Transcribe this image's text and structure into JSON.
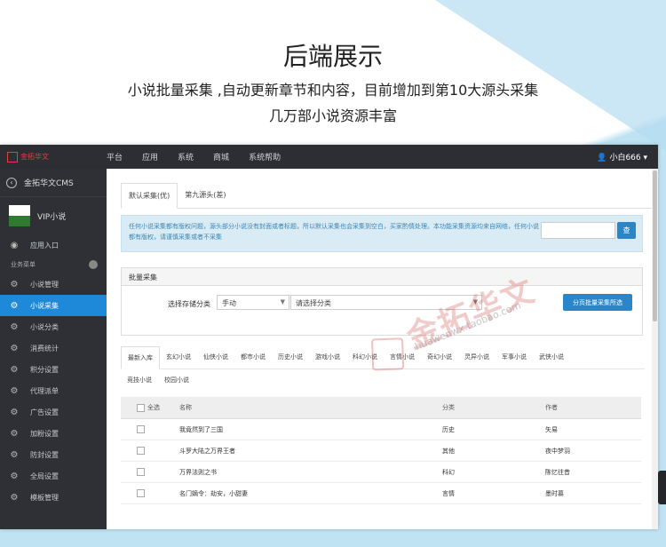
{
  "hero": {
    "title": "后端展示",
    "line1": "小说批量采集 ,自动更新章节和内容，目前增加到第10大源头采集",
    "line2": "几万部小说资源丰富"
  },
  "topbar": {
    "logo": "金拓华文",
    "nav": [
      "平台",
      "应用",
      "系统",
      "商城",
      "系统帮助"
    ],
    "user": "小白666 ▾"
  },
  "sidebar": {
    "brand": "金拓华文CMS",
    "vip": "VIP小说",
    "vip_img": "小说",
    "app_entry": "应用入口",
    "section": "业务菜单",
    "items": [
      "小说管理",
      "小说采集",
      "小说分类",
      "消费统计",
      "积分设置",
      "代理派单",
      "广告设置",
      "加粉设置",
      "防封设置",
      "全局设置",
      "模板管理"
    ],
    "active_index": 1
  },
  "main": {
    "tabs": [
      "默认采集(优)",
      "第九源头(差)"
    ],
    "notice": "任何小说采集都有版权问题，源头部分小说没有封面或者标题，所以默认采集也会采集到空白，买家酌情处理。本功能采集资源均来自网络，任何小说都有版权，请谨慎采集或者不采集",
    "search_btn": "查",
    "panel_title": "批量采集",
    "label": "选择存储分类",
    "select1": "手动",
    "select2": "请选择分类",
    "batch_btn": "分页批量采集所选",
    "cat_tabs_row1": [
      "最新入库",
      "玄幻小说",
      "仙侠小说",
      "都市小说",
      "历史小说",
      "游戏小说",
      "科幻小说",
      "言情小说",
      "奇幻小说",
      "灵异小说",
      "军事小说",
      "武侠小说"
    ],
    "cat_tabs_row2": [
      "竞技小说",
      "校园小说"
    ],
    "table_headers": [
      "全选",
      "名称",
      "分类",
      "作者"
    ],
    "rows": [
      {
        "name": "我竟然到了三国",
        "cat": "历史",
        "author": "矢易"
      },
      {
        "name": "斗罗大陆之万界王者",
        "cat": "其他",
        "author": "夜中梦羽"
      },
      {
        "name": "万界法则之书",
        "cat": "科幻",
        "author": "陈忆往昔"
      },
      {
        "name": "名门嫡令：劫安，小甜妻",
        "cat": "言情",
        "author": "墨时慕"
      }
    ]
  },
  "watermark": {
    "text": "金拓华文",
    "url": "huawenwx.taobao.com"
  }
}
